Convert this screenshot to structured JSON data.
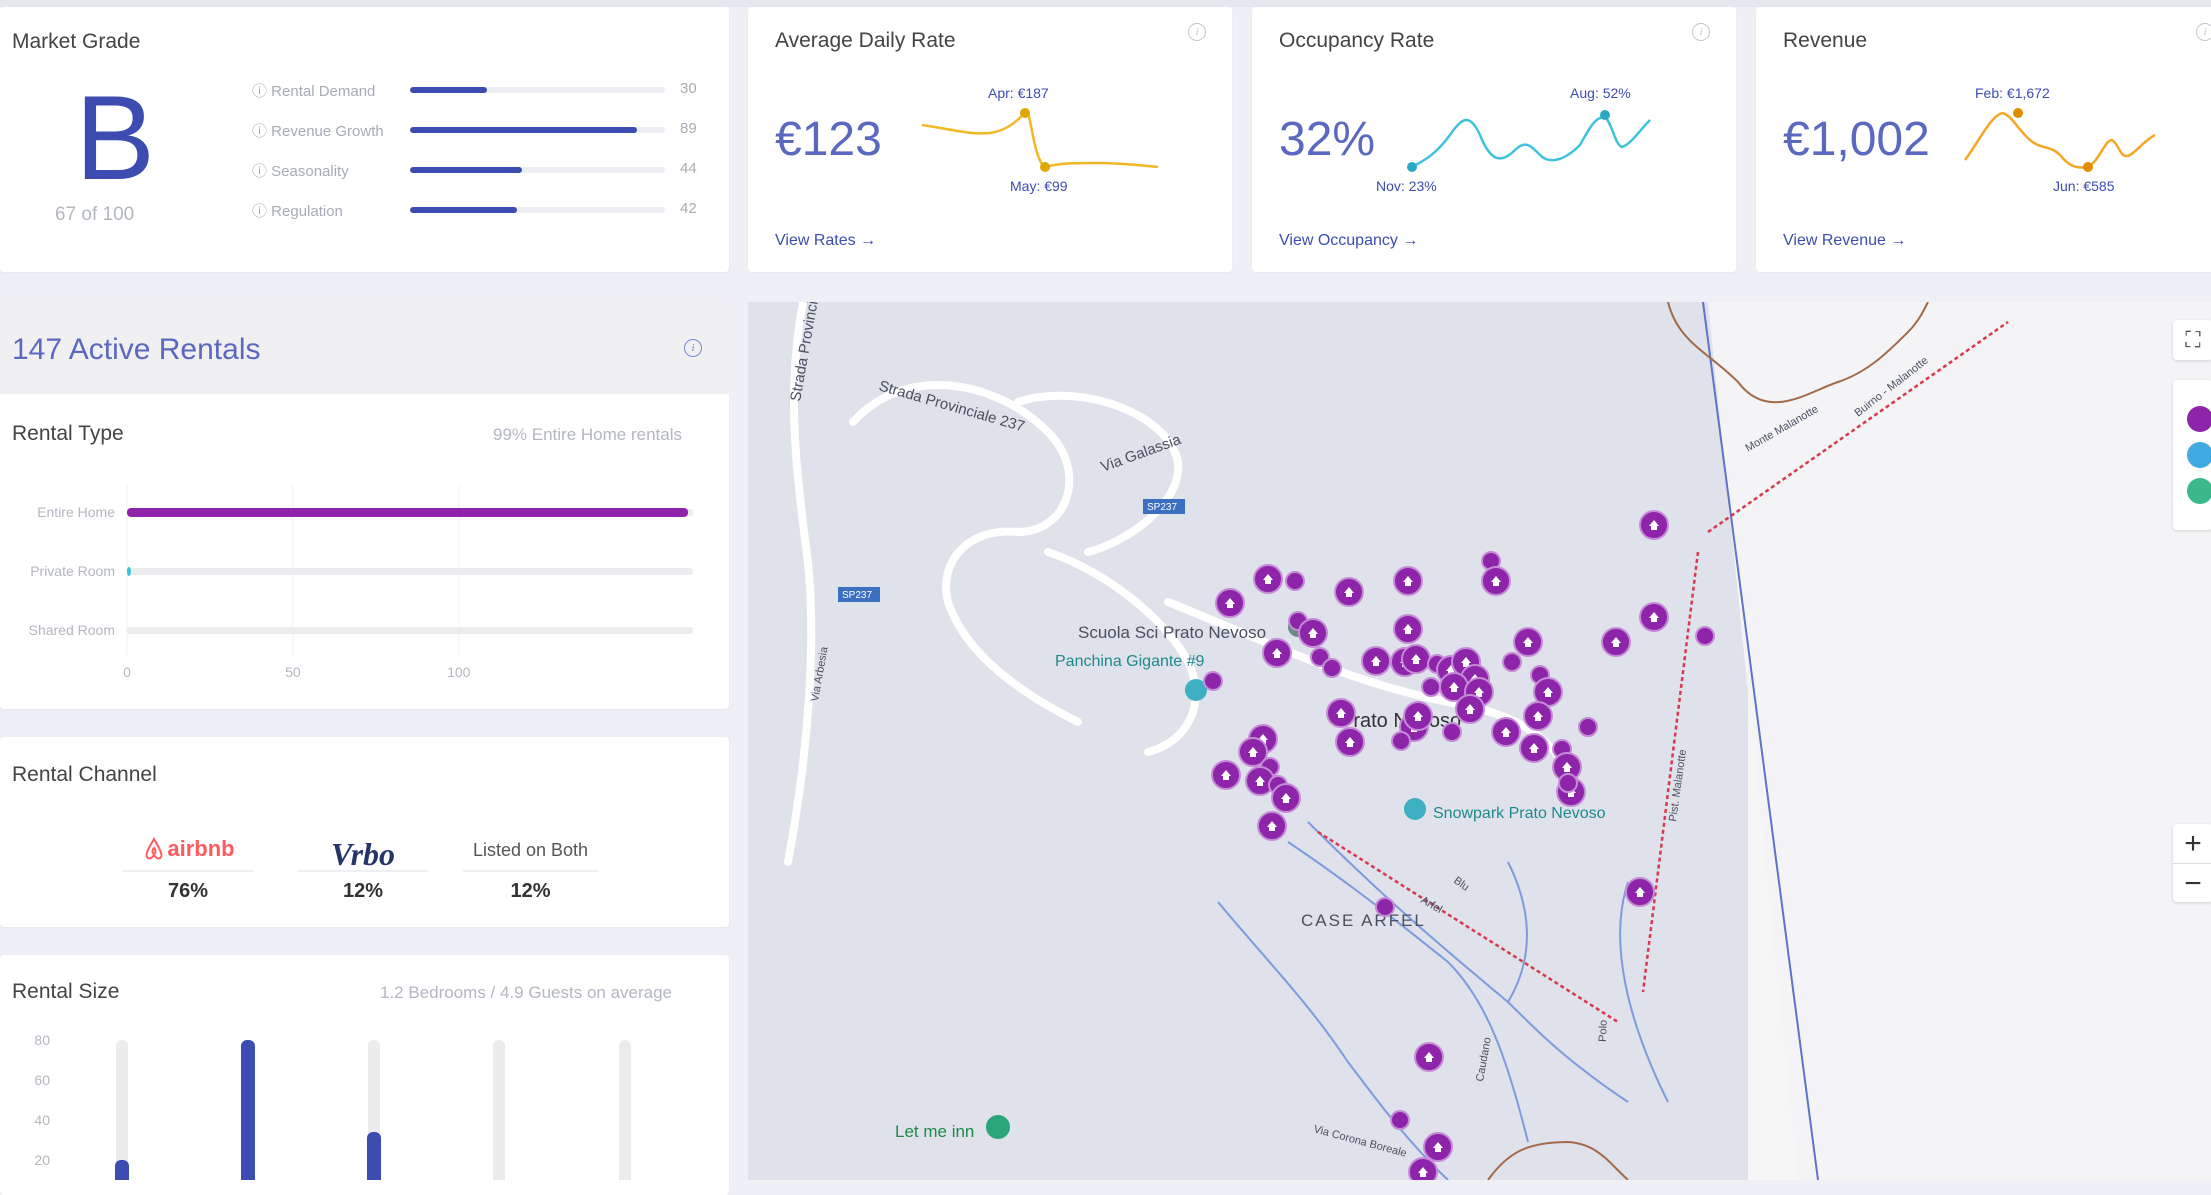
{
  "market_grade": {
    "title": "Market Grade",
    "grade": "B",
    "score_text": "67 of 100",
    "metrics": [
      {
        "label": "Rental Demand",
        "value": "30",
        "fraction": 0.3
      },
      {
        "label": "Revenue Growth",
        "value": "89",
        "fraction": 0.89
      },
      {
        "label": "Seasonality",
        "value": "44",
        "fraction": 0.44
      },
      {
        "label": "Regulation",
        "value": "42",
        "fraction": 0.42
      }
    ]
  },
  "kpis": [
    {
      "title": "Average Daily Rate",
      "value": "€123",
      "high_label": "Apr: €187",
      "low_label": "May: €99",
      "link": "View Rates →",
      "color": "#f2b824"
    },
    {
      "title": "Occupancy Rate",
      "value": "32%",
      "high_label": "Aug: 52%",
      "low_label": "Nov: 23%",
      "link": "View Occupancy →",
      "color": "#3fc2dc"
    },
    {
      "title": "Revenue",
      "value": "€1,002",
      "high_label": "Feb: €1,672",
      "low_label": "Jun: €585",
      "link": "View Revenue →",
      "color": "#f5a623"
    }
  ],
  "active_rentals": {
    "title": "147 Active Rentals"
  },
  "rental_type": {
    "title": "Rental Type",
    "subtitle": "99% Entire Home rentals",
    "chart_data": {
      "type": "bar",
      "orientation": "horizontal",
      "categories": [
        "Entire Home",
        "Private Room",
        "Shared Room"
      ],
      "values": [
        146,
        1,
        0
      ],
      "xlim": [
        0,
        145
      ],
      "xticks": [
        "0",
        "50",
        "100"
      ],
      "colors": [
        "#8e24aa",
        "#3fc2dc",
        "#e6e6e6"
      ]
    }
  },
  "rental_channel": {
    "title": "Rental Channel",
    "channels": [
      {
        "name": "airbnb",
        "value": "76%"
      },
      {
        "name": "Vrbo",
        "value": "12%"
      },
      {
        "name": "Listed on Both",
        "value": "12%"
      }
    ]
  },
  "rental_size": {
    "title": "Rental Size",
    "subtitle": "1.2 Bedrooms / 4.9 Guests on average",
    "chart_data": {
      "type": "bar",
      "categories": [
        "",
        "",
        "",
        "",
        ""
      ],
      "values": [
        20,
        80,
        34,
        0,
        0
      ],
      "ylim": [
        0,
        80
      ],
      "yticks": [
        "80",
        "60",
        "40",
        "20"
      ]
    }
  },
  "map": {
    "labels": {
      "strada_prov": "Strada Provinciale",
      "strada_237": "Strada Provinciale 237",
      "via_galassia": "Via Galassia",
      "sp237": "SP237",
      "via_arbesia": "Via Arbesia",
      "scuola": "Scuola Sci Prato Nevoso",
      "panchina": "Panchina Gigante #9",
      "prato": "Prato Nevoso",
      "snowpark": "Snowpark Prato Nevoso",
      "case_arfel": "CASE ARFEL",
      "monte_malanotte": "Monte Malanotte",
      "buirno": "Buirno - Malanotte",
      "let_me_inn": "Let me inn",
      "pist_malanotte": "Pist. Malanotte",
      "arfel": "Arfel",
      "blu": "Blu",
      "via_corona": "Via Corona Boreale",
      "caudano": "Caudano",
      "polo": "Polo"
    },
    "zoom_in": "+",
    "zoom_out": "−"
  }
}
